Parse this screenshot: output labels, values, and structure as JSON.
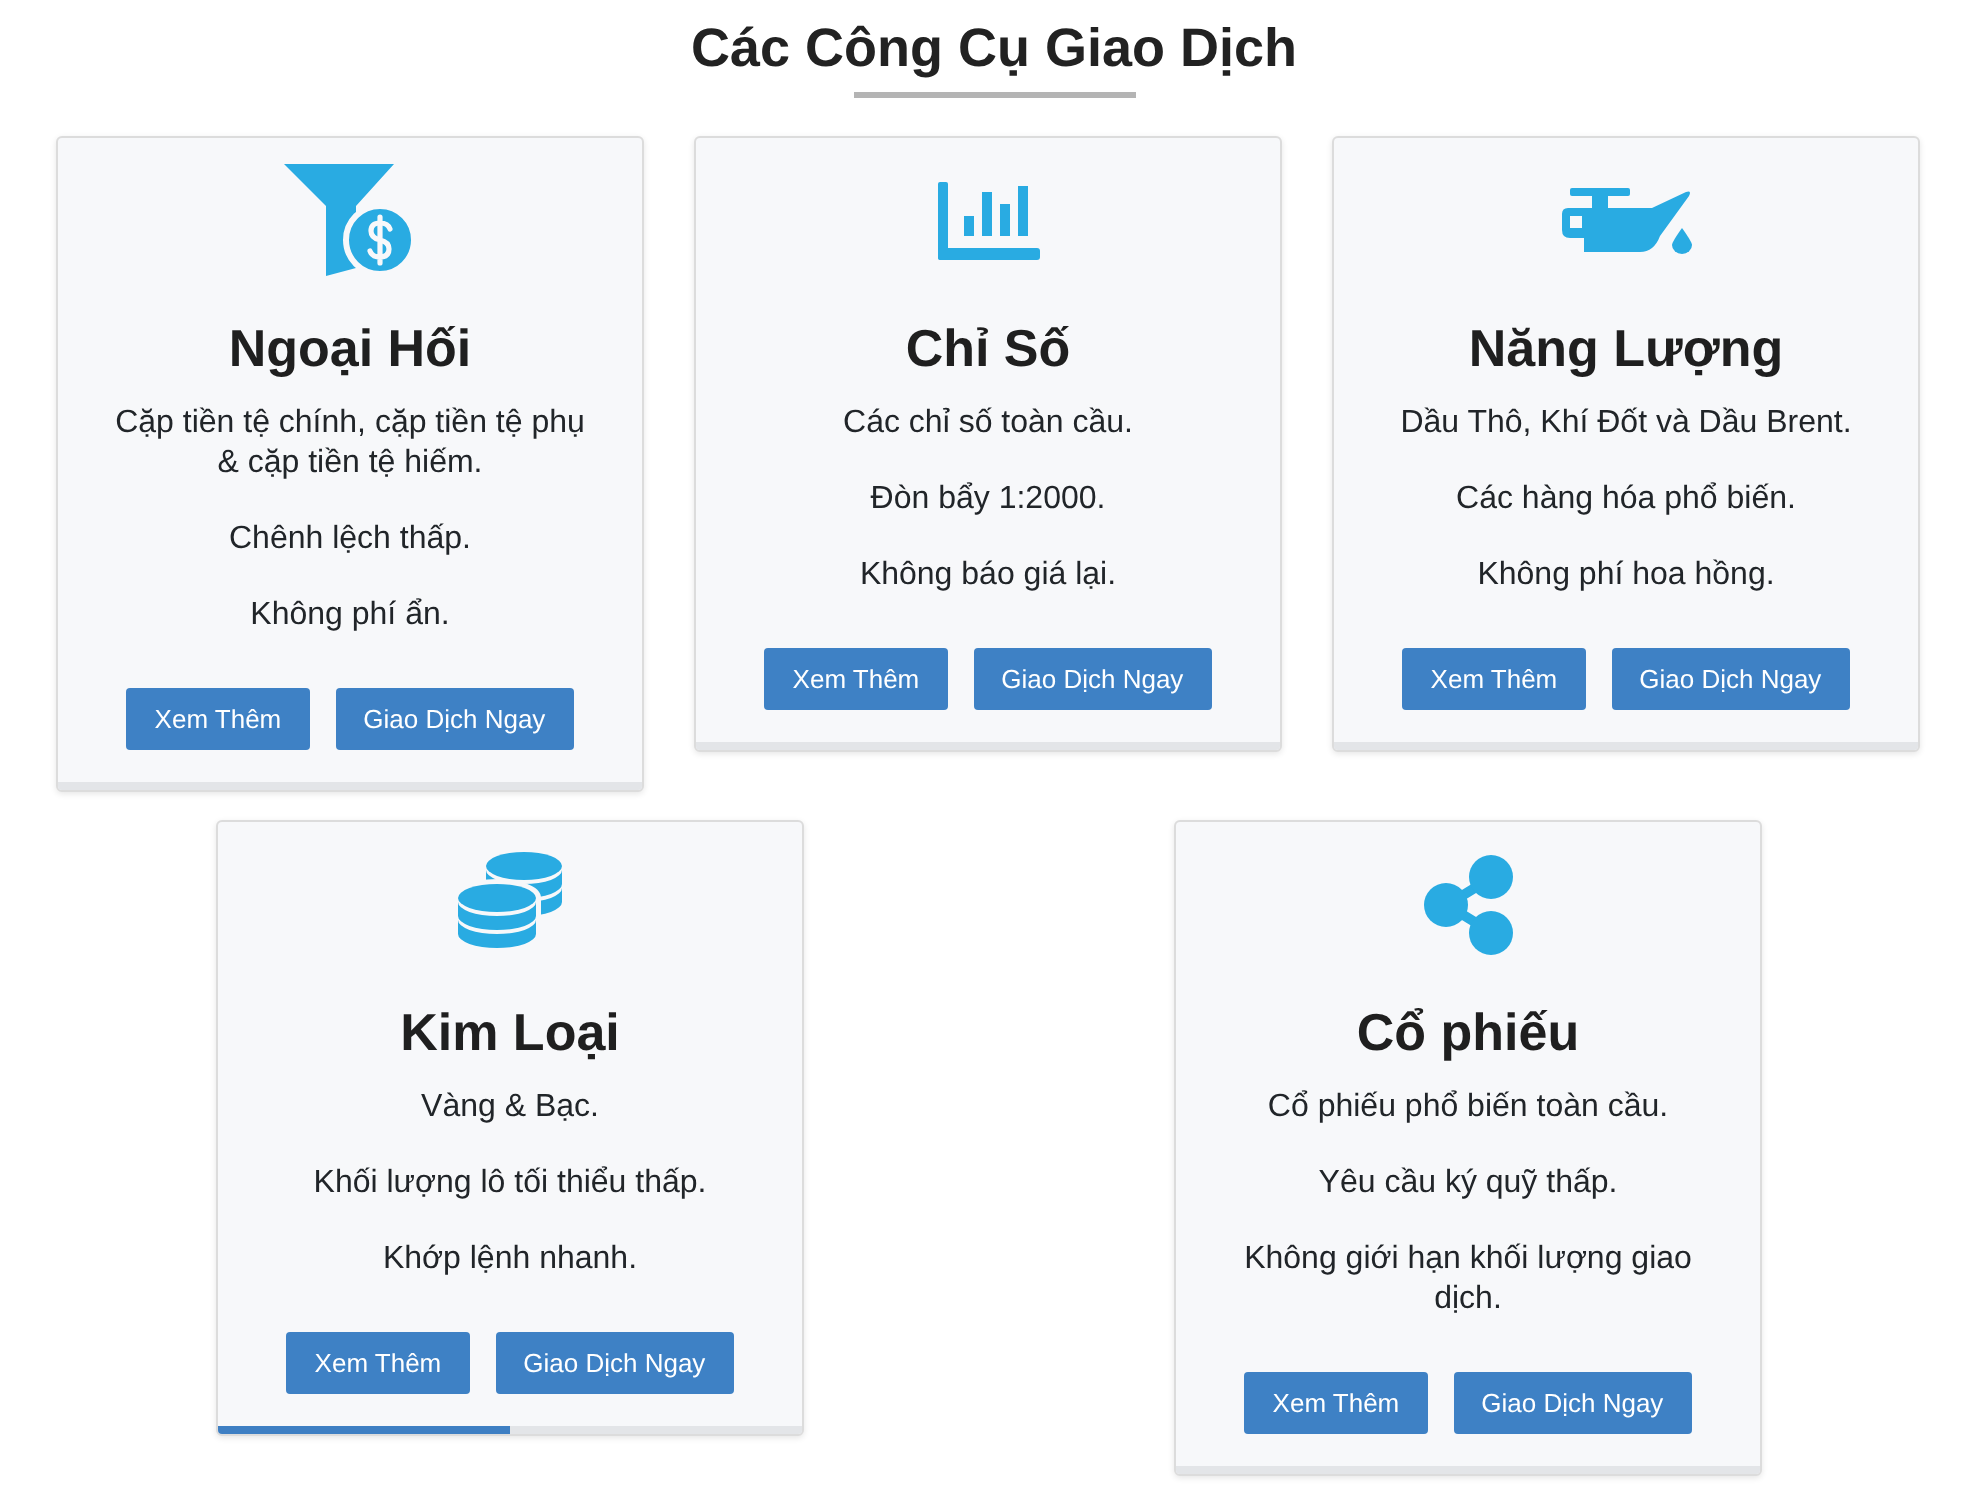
{
  "heading": {
    "title": "Các Công Cụ Giao Dịch"
  },
  "cards": [
    {
      "title": "Ngoại Hối",
      "lines": [
        "Cặp tiền tệ chính, cặp tiền tệ phụ & cặp tiền tệ hiếm.",
        "Chênh lệch thấp.",
        "Không phí ẩn."
      ],
      "buttons": [
        "Xem Thêm",
        "Giao Dịch Ngay"
      ],
      "level": 0
    },
    {
      "title": "Chỉ Số",
      "lines": [
        "Các chỉ số toàn cầu.",
        "Đòn bẩy 1:2000.",
        "Không báo giá lại."
      ],
      "buttons": [
        "Xem Thêm",
        "Giao Dịch Ngay"
      ],
      "level": 0
    },
    {
      "title": "Năng Lượng",
      "lines": [
        "Dầu Thô, Khí Đốt và Dầu Brent.",
        "Các hàng hóa phổ biến.",
        "Không phí hoa hồng."
      ],
      "buttons": [
        "Xem Thêm",
        "Giao Dịch Ngay"
      ],
      "level": 0
    },
    {
      "title": "Kim Loại",
      "lines": [
        "Vàng & Bạc.",
        "Khối lượng lô tối thiểu thấp.",
        "Khớp lệnh nhanh."
      ],
      "buttons": [
        "Xem Thêm",
        "Giao Dịch Ngay"
      ],
      "level": 0.5
    },
    {
      "title": "Cổ phiếu",
      "lines": [
        "Cổ phiếu phổ biến toàn cầu.",
        "Yêu cầu ký quỹ thấp.",
        "Không giới hạn khối lượng giao dịch."
      ],
      "buttons": [
        "Xem Thêm",
        "Giao Dịch Ngay"
      ],
      "level": 0
    }
  ]
}
